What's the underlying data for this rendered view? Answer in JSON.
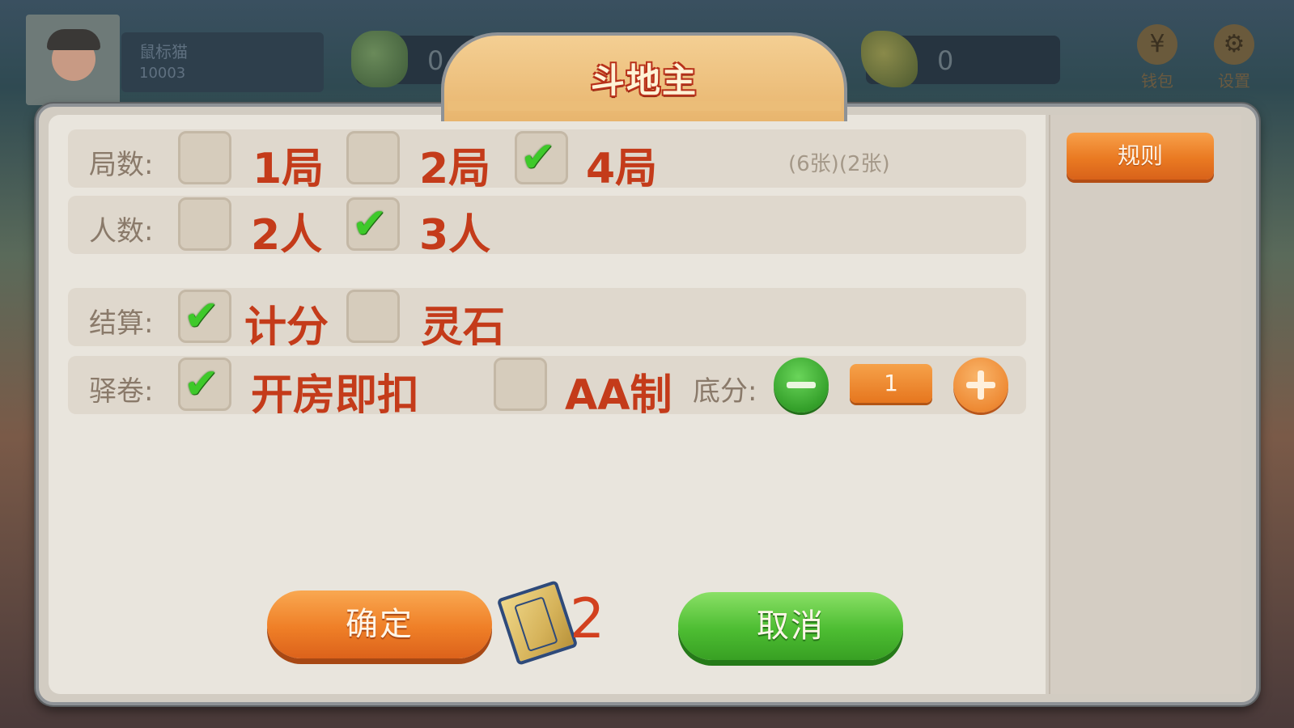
{
  "top_bar": {
    "player_name": "鼠标猫",
    "player_id": "10003",
    "resource_1": "0",
    "resource_2": "0",
    "wallet_label": "钱包",
    "settings_label": "设置"
  },
  "dialog": {
    "title": "斗地主",
    "rules_button": "规则",
    "rounds": {
      "label": "局数:",
      "options": [
        {
          "label": "1局",
          "checked": false
        },
        {
          "label": "2局",
          "checked": false
        },
        {
          "label": "4局",
          "checked": true
        }
      ],
      "note": "(6张)(2张)"
    },
    "players": {
      "label": "人数:",
      "options": [
        {
          "label": "2人",
          "checked": false
        },
        {
          "label": "3人",
          "checked": true
        }
      ]
    },
    "settlement": {
      "label": "结算:",
      "options": [
        {
          "label": "计分",
          "checked": true
        },
        {
          "label": "灵石",
          "checked": false
        }
      ]
    },
    "payment": {
      "label": "驿卷:",
      "options": [
        {
          "label": "开房即扣",
          "checked": true
        },
        {
          "label": "AA制",
          "checked": false
        }
      ],
      "base_score_label": "底分:",
      "base_score": "1"
    },
    "confirm_button": "确定",
    "cost": "2",
    "cancel_button": "取消"
  },
  "colors": {
    "accent_orange": "#ea7a22",
    "accent_green": "#4dbd32",
    "option_text": "#c43b1a",
    "label_text": "#8a7a6a",
    "check": "#3ec92a"
  }
}
